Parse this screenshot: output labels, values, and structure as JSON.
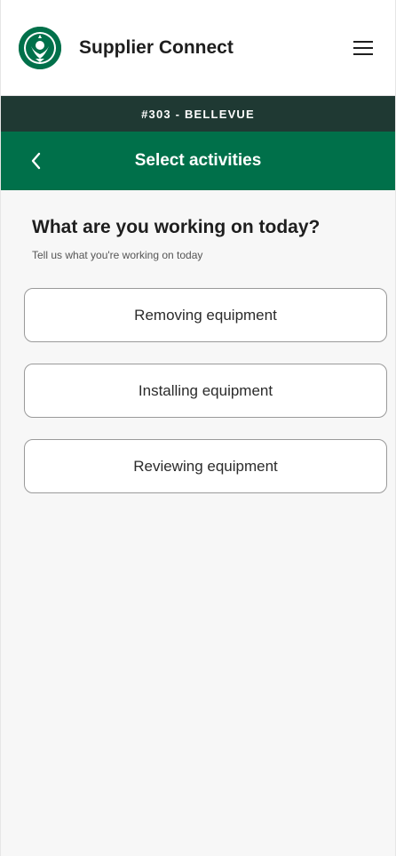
{
  "header": {
    "app_title": "Supplier Connect",
    "logo_icon": "siren-logo-icon",
    "menu_icon": "hamburger-menu-icon"
  },
  "store_bar": {
    "label": "#303 - BELLEVUE"
  },
  "nav": {
    "back_icon": "chevron-left-icon",
    "title": "Select activities"
  },
  "main": {
    "heading": "What are you working on today?",
    "subheading": "Tell us what you're working on today",
    "options": [
      {
        "label": "Removing equipment"
      },
      {
        "label": "Installing equipment"
      },
      {
        "label": "Reviewing equipment"
      }
    ]
  },
  "colors": {
    "brand_green": "#00704a",
    "store_bar": "#1f3933",
    "background": "#f7f7f7"
  }
}
